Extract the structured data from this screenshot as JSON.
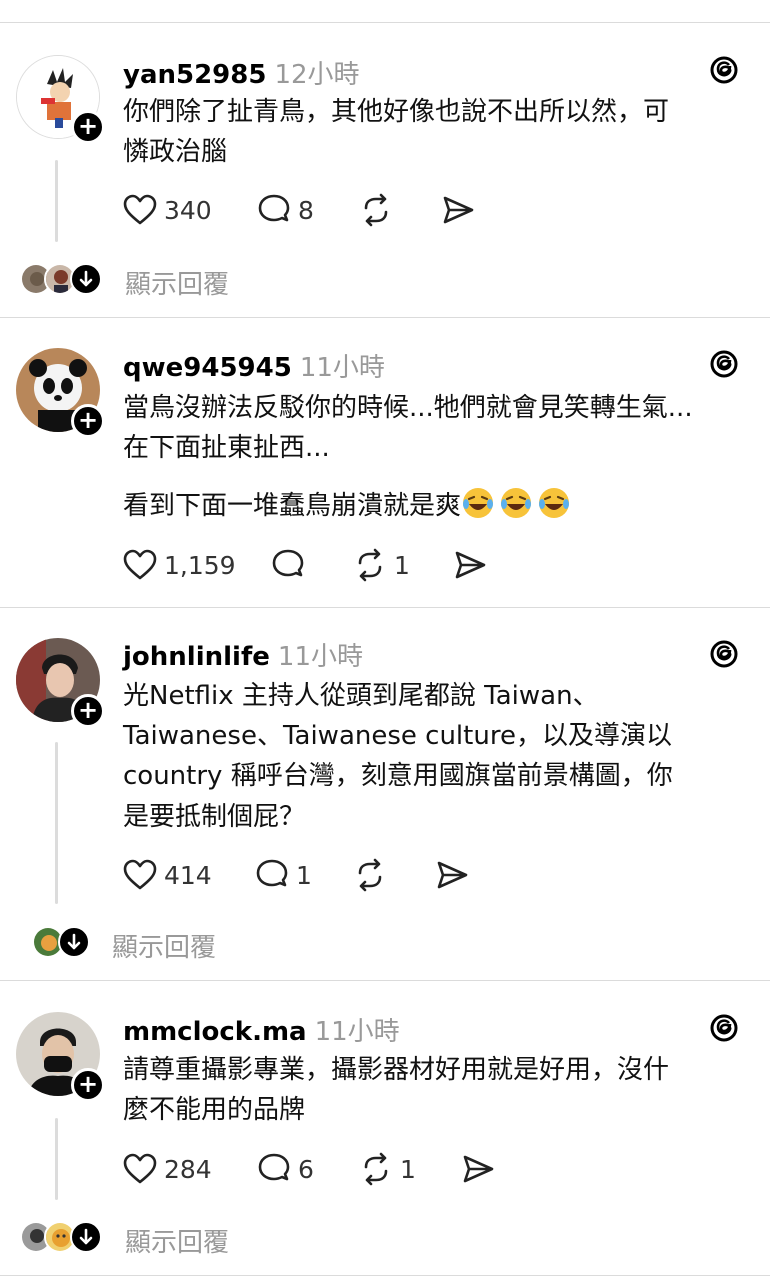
{
  "posts": [
    {
      "username": "yan52985",
      "time": "12小時",
      "lines": [
        "你們除了扯青鳥，其他好像也說不出所以然，可",
        "憐政治腦"
      ],
      "likes": "340",
      "comments": "8",
      "reposts": "",
      "show_replies": "顯示回覆"
    },
    {
      "username": "qwe945945",
      "time": "11小時",
      "lines": [
        "當鳥沒辦法反駁你的時候...牠們就會見笑轉生氣...",
        "在下面扯東扯西..."
      ],
      "extra_line": "看到下面一堆蠢鳥崩潰就是爽",
      "likes": "1,159",
      "comments": "",
      "reposts": "1"
    },
    {
      "username": "johnlinlife",
      "time": "11小時",
      "lines": [
        "光Netflix 主持人從頭到尾都說 Taiwan、",
        "Taiwanese、Taiwanese culture，以及導演以",
        " country 稱呼台灣，刻意用國旗當前景構圖，你",
        "是要抵制個屁？"
      ],
      "likes": "414",
      "comments": "1",
      "reposts": "",
      "show_replies": "顯示回覆"
    },
    {
      "username": "mmclock.ma",
      "time": "11小時",
      "lines": [
        "請尊重攝影專業，攝影器材好用就是好用，沒什",
        "麼不能用的品牌"
      ],
      "likes": "284",
      "comments": "6",
      "reposts": "1",
      "show_replies": "顯示回覆"
    }
  ],
  "icons": {
    "like": "heart-icon",
    "comment": "comment-bubble-icon",
    "repost": "repost-icon",
    "share": "share-send-icon",
    "app": "threads-logo-icon"
  }
}
